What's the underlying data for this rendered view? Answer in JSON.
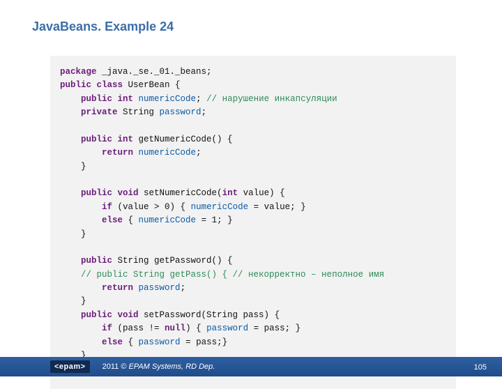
{
  "title": "JavaBeans. Example 24",
  "code": {
    "l1_kw1": "package",
    "l1_rest": " _java._se._01._beans;",
    "l2_kw1": "public class",
    "l2_rest": " UserBean {",
    "l3_kw": "public int",
    "l3_mem": "numericCode",
    "l3_end": "; ",
    "l3_cmt": "// нарушение инкапсуляции",
    "l4_kw": "private",
    "l4_rest": " String ",
    "l4_mem": "password",
    "l4_end": ";",
    "l6_kw": "public int",
    "l6_rest": " getNumericCode() {",
    "l7_kw": "return",
    "l7_sp": " ",
    "l7_mem": "numericCode",
    "l7_end": ";",
    "l8": "    }",
    "l10_kw1": "public void",
    "l10_rest1": " setNumericCode(",
    "l10_kw2": "int",
    "l10_rest2": " value) {",
    "l11_kw": "if",
    "l11_rest1": " (value > 0) { ",
    "l11_mem": "numericCode",
    "l11_rest2": " = value; }",
    "l12_kw": "else",
    "l12_rest1": " { ",
    "l12_mem": "numericCode",
    "l12_rest2": " = 1; }",
    "l13": "    }",
    "l15_kw": "public",
    "l15_rest": " String getPassword() {",
    "l16_cmt": "    // public String getPass() { // некорректно – неполное имя",
    "l17_kw": "return",
    "l17_sp": " ",
    "l17_mem": "password",
    "l17_end": ";",
    "l18": "    }",
    "l19_kw": "public void",
    "l19_rest": " setPassword(String pass) {",
    "l20_kw": "if",
    "l20_rest1": " (pass != ",
    "l20_kw2": "null",
    "l20_rest2": ") { ",
    "l20_mem": "password",
    "l20_rest3": " = pass; }",
    "l21_kw": "else",
    "l21_rest1": " { ",
    "l21_mem": "password",
    "l21_rest2": " = pass;}",
    "l22": "    }",
    "l23": "}"
  },
  "footer": {
    "logo": "<epam>",
    "year": "2011",
    "copy_rest": " © EPAM Systems, RD Dep.",
    "page": "105"
  }
}
